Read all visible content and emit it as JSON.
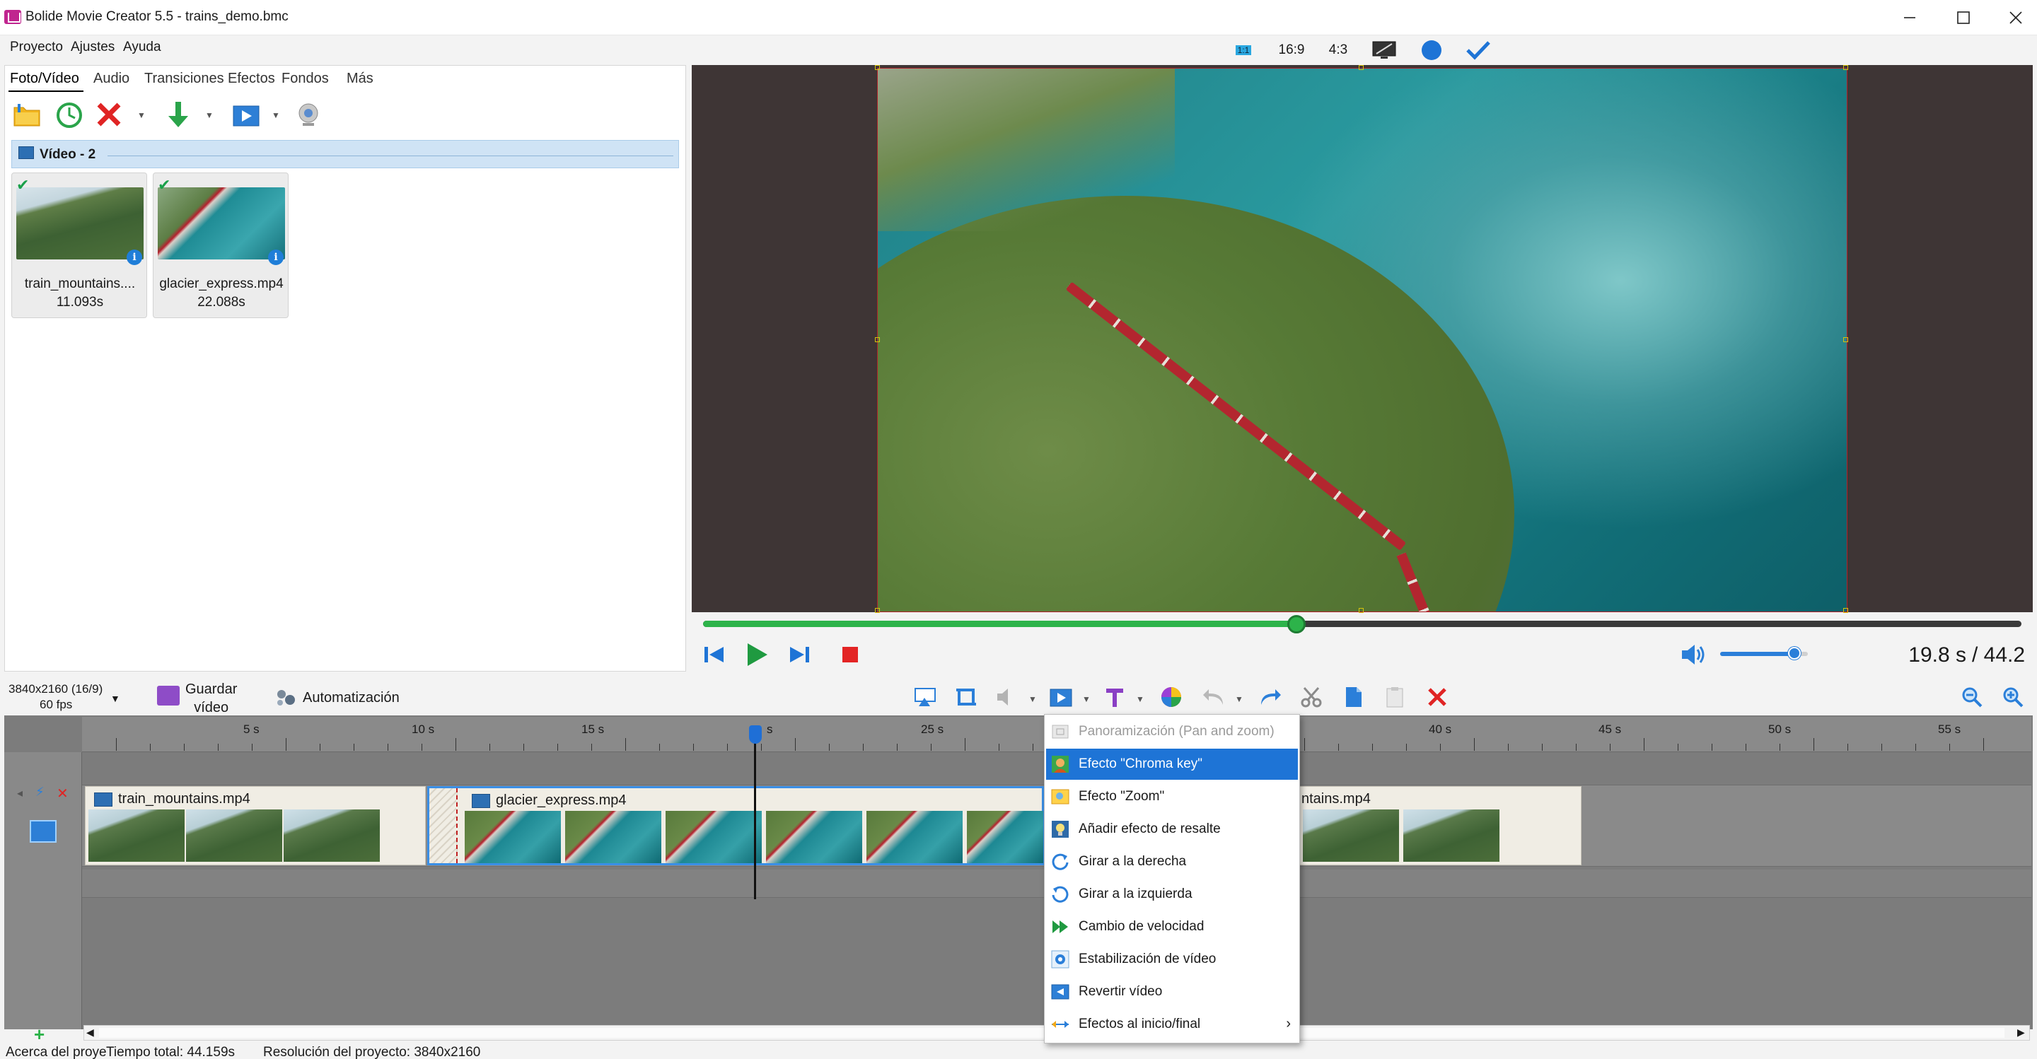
{
  "window": {
    "title": "Bolide Movie Creator 5.5 - trains_demo.bmc"
  },
  "menu": [
    "Proyecto",
    "Ajustes",
    "Ayuda"
  ],
  "top_toolbar": {
    "ratio_1_1": "1:1",
    "ratio_16_9": "16:9",
    "ratio_4_3": "4:3"
  },
  "tabs": [
    "Foto/Vídeo",
    "Audio",
    "Transiciones",
    "Efectos",
    "Fondos",
    "Más"
  ],
  "group": {
    "title": "Vídeo - 2"
  },
  "clips": [
    {
      "name": "train_mountains....",
      "duration": "11.093s"
    },
    {
      "name": "glacier_express.mp4",
      "duration": "22.088s"
    }
  ],
  "playback": {
    "current_time": "19.8 s",
    "total_time": "/ 44.2 s",
    "progress": 0.45,
    "volume": 0.85
  },
  "project": {
    "resolution_line1": "3840x2160 (16/9)",
    "resolution_line2": "60 fps",
    "save_line1": "Guardar",
    "save_line2": "vídeo",
    "automation": "Automatización"
  },
  "ruler": [
    "5 s",
    "10 s",
    "15 s",
    "s",
    "25 s",
    "40 s",
    "45 s",
    "50 s",
    "55 s"
  ],
  "timeline_clips": [
    {
      "name": "train_mountains.mp4"
    },
    {
      "name": "glacier_express.mp4"
    },
    {
      "name": "ntains.mp4"
    }
  ],
  "context_menu": [
    {
      "label": "Panoramización (Pan and zoom)",
      "state": "disabled",
      "icon": "pan-zoom-icon"
    },
    {
      "label": "Efecto \"Chroma key\"",
      "state": "selected",
      "icon": "chroma-key-icon"
    },
    {
      "label": "Efecto \"Zoom\"",
      "state": "normal",
      "icon": "zoom-effect-icon"
    },
    {
      "label": "Añadir efecto de resalte",
      "state": "normal",
      "icon": "highlight-icon"
    },
    {
      "label": "Girar a la derecha",
      "state": "normal",
      "icon": "rotate-right-icon"
    },
    {
      "label": "Girar a la izquierda",
      "state": "normal",
      "icon": "rotate-left-icon"
    },
    {
      "label": "Cambio de velocidad",
      "state": "normal",
      "icon": "speed-icon"
    },
    {
      "label": "Estabilización de vídeo",
      "state": "normal",
      "icon": "stabilize-icon"
    },
    {
      "label": "Revertir vídeo",
      "state": "normal",
      "icon": "reverse-icon"
    },
    {
      "label": "Efectos al inicio/final",
      "state": "submenu",
      "icon": "fade-effects-icon"
    }
  ],
  "status_bar": {
    "about": "Acerca del proye",
    "total_time": "Tiempo total: 44.159s",
    "resolution": "Resolución del proyecto:  3840x2160"
  },
  "colors": {
    "accent": "#1e74d6",
    "play": "#2db34a",
    "stop": "#e32424"
  }
}
